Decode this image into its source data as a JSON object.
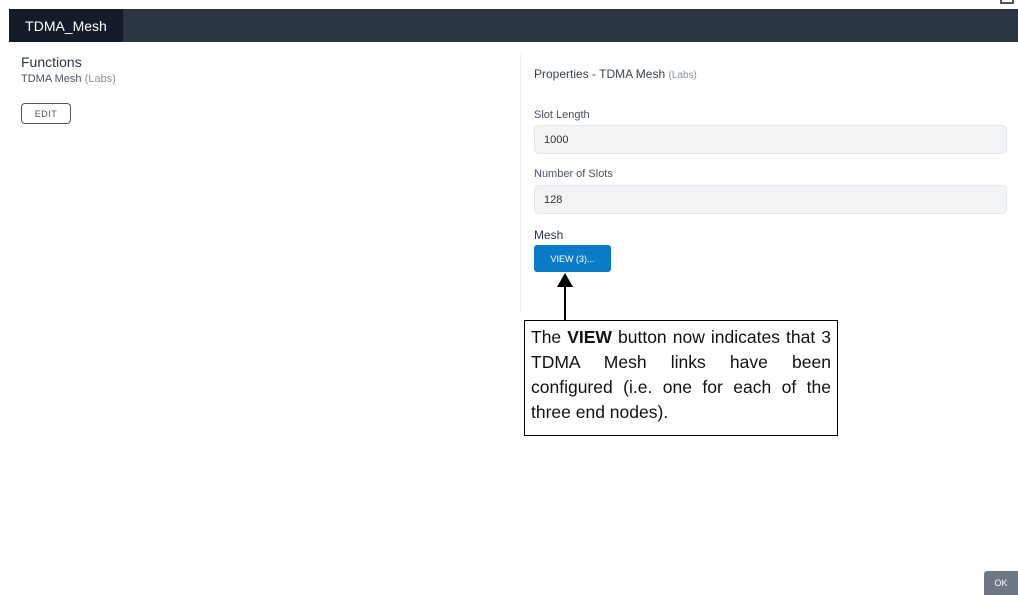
{
  "window": {
    "tab_title": "TDMA_Mesh"
  },
  "functions": {
    "title": "Functions",
    "item_name": "TDMA Mesh",
    "item_tag": "(Labs)",
    "edit_label": "EDIT"
  },
  "properties": {
    "title_prefix": "Properties  - TDMA Mesh",
    "title_tag": "(Labs)",
    "slot_length_label": "Slot Length",
    "slot_length_value": "1000",
    "num_slots_label": "Number of Slots",
    "num_slots_value": "128",
    "mesh_label": "Mesh",
    "view_label": "VIEW (3)..."
  },
  "callout": {
    "pre": "The ",
    "bold": "VIEW",
    "post": " button now indicates that 3 TDMA Mesh links have been configured (i.e. one for each of the three end nodes)."
  },
  "footer": {
    "ok_label": "OK"
  }
}
